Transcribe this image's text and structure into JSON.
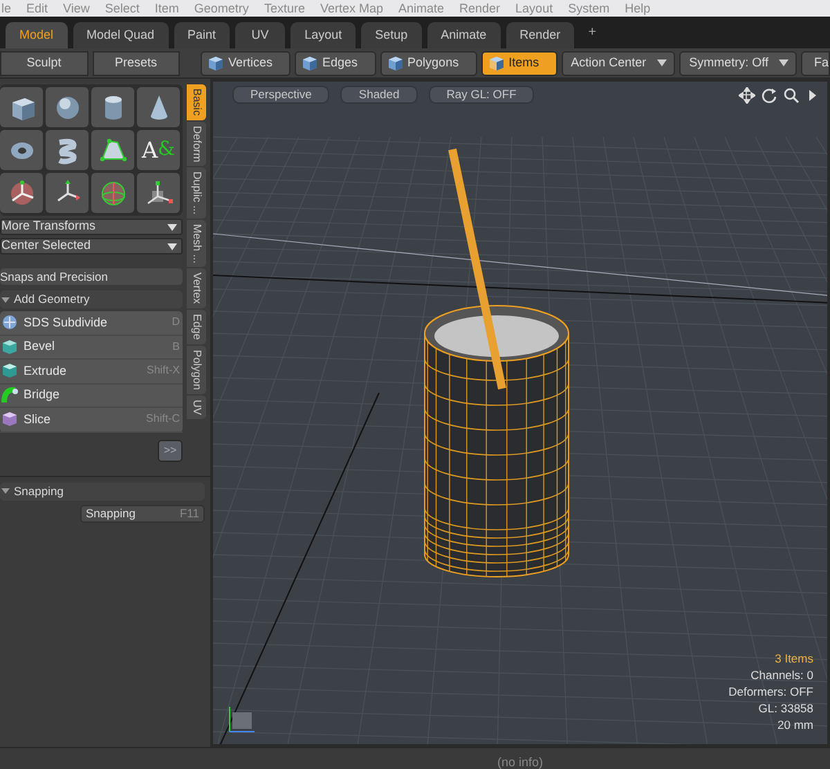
{
  "menu_bar": [
    "le",
    "Edit",
    "View",
    "Select",
    "Item",
    "Geometry",
    "Texture",
    "Vertex Map",
    "Animate",
    "Render",
    "Layout",
    "System",
    "Help"
  ],
  "layout_tabs": [
    {
      "label": "Model",
      "selected": true
    },
    {
      "label": "Model Quad",
      "selected": false
    },
    {
      "label": "Paint",
      "selected": false
    },
    {
      "label": "UV",
      "selected": false
    },
    {
      "label": "Layout",
      "selected": false
    },
    {
      "label": "Setup",
      "selected": false
    },
    {
      "label": "Animate",
      "selected": false
    },
    {
      "label": "Render",
      "selected": false
    }
  ],
  "add_tab": "+",
  "toolbar": {
    "left_buttons": [
      "Sculpt",
      "Presets"
    ],
    "modes": [
      {
        "label": "Vertices",
        "selected": false
      },
      {
        "label": "Edges",
        "selected": false
      },
      {
        "label": "Polygons",
        "selected": false
      },
      {
        "label": "Items",
        "selected": true
      }
    ],
    "dropdowns": [
      "Action Center",
      "Symmetry: Off"
    ],
    "cut_button": "Fa"
  },
  "tool_grid": [
    {
      "kind": "cube"
    },
    {
      "kind": "sphere"
    },
    {
      "kind": "cylinder"
    },
    {
      "kind": "cone"
    },
    {
      "kind": "torus"
    },
    {
      "kind": "spiral"
    },
    {
      "kind": "pen"
    },
    {
      "kind": "text",
      "glyphs": [
        "A",
        "&"
      ]
    },
    {
      "kind": "move"
    },
    {
      "kind": "transform"
    },
    {
      "kind": "rotate"
    },
    {
      "kind": "scale"
    }
  ],
  "transform_dropdowns": [
    "More Transforms",
    "Center Selected"
  ],
  "snaps_button": "Snaps and Precision",
  "add_geometry": {
    "title": "Add Geometry",
    "expanded": true,
    "items": [
      {
        "label": "SDS Subdivide",
        "shortcut": "D",
        "kind": "sds"
      },
      {
        "label": "Bevel",
        "shortcut": "B",
        "kind": "bevel"
      },
      {
        "label": "Extrude",
        "shortcut": "Shift-X",
        "kind": "extrude"
      },
      {
        "label": "Bridge",
        "kind": "bridge"
      },
      {
        "label": "Slice",
        "shortcut": "Shift-C",
        "kind": "slice"
      }
    ],
    "more_button": ">>"
  },
  "side_tabs": [
    {
      "label": "Basic",
      "selected": true
    },
    {
      "label": "Deform",
      "selected": false
    },
    {
      "label": "Duplic ...",
      "selected": false
    },
    {
      "label": "Mesh ...",
      "selected": false
    },
    {
      "label": "Vertex",
      "selected": false
    },
    {
      "label": "Edge",
      "selected": false
    },
    {
      "label": "Polygon",
      "selected": false
    },
    {
      "label": "UV",
      "selected": false
    }
  ],
  "snapping": {
    "title": "Snapping",
    "expanded": true,
    "button": {
      "label": "Snapping",
      "shortcut": "F11"
    }
  },
  "viewport": {
    "view_buttons": [
      "Perspective",
      "Shaded",
      "Ray GL: OFF"
    ],
    "info": [
      {
        "text": "3 Items",
        "highlighted": true
      },
      {
        "text": "Channels: 0",
        "highlighted": false
      },
      {
        "text": "Deformers: OFF",
        "highlighted": false
      },
      {
        "text": "GL: 33858",
        "highlighted": false
      },
      {
        "text": "20 mm",
        "highlighted": false
      }
    ]
  },
  "status_bar": "(no info)"
}
